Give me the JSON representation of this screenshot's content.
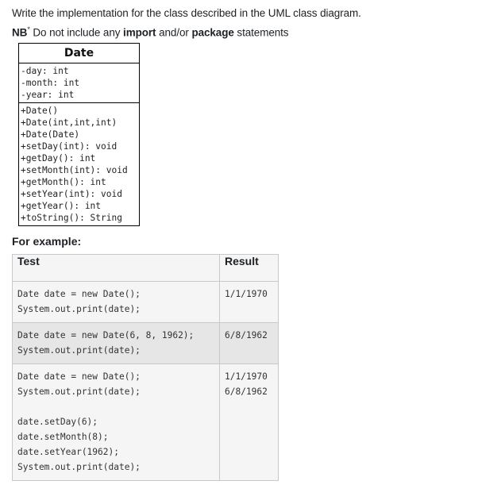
{
  "prompt": {
    "line1": "Write the implementation for the class described in the UML class diagram.",
    "nb_label": "NB",
    "nb_star": "*",
    "nb_text1": " Do not include any ",
    "import_word": "import",
    "nb_text2": " and/or ",
    "package_word": "package",
    "nb_text3": " statements"
  },
  "uml": {
    "class_name": "Date",
    "attributes": [
      "-day: int",
      "-month: int",
      "-year: int"
    ],
    "methods": [
      "+Date()",
      "+Date(int,int,int)",
      "+Date(Date)",
      "+setDay(int): void",
      "+getDay(): int",
      "+setMonth(int): void",
      "+getMonth(): int",
      "+setYear(int): void",
      "+getYear(): int",
      "+toString(): String"
    ]
  },
  "examples": {
    "heading": "For example:",
    "col_test": "Test",
    "col_result": "Result",
    "rows": [
      {
        "test": [
          "Date date = new Date();",
          "System.out.print(date);"
        ],
        "result": [
          "1/1/1970"
        ]
      },
      {
        "test": [
          "Date date = new Date(6, 8, 1962);",
          "System.out.print(date);"
        ],
        "result": [
          "6/8/1962"
        ]
      },
      {
        "test": [
          "Date date = new Date();",
          "System.out.print(date);",
          "",
          "date.setDay(6);",
          "date.setMonth(8);",
          "date.setYear(1962);",
          "System.out.print(date);"
        ],
        "result": [
          "1/1/1970",
          "6/8/1962"
        ]
      }
    ]
  }
}
